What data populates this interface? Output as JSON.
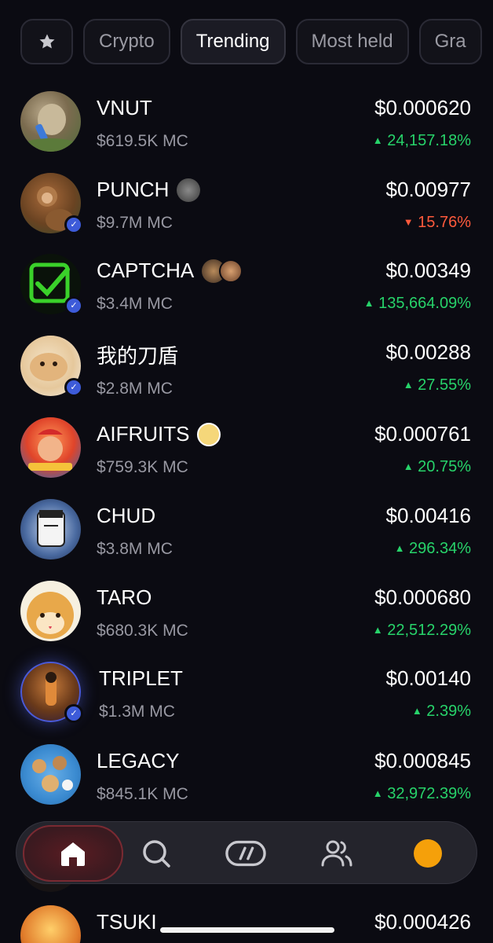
{
  "filters": {
    "items": [
      {
        "label": "Crypto",
        "active": false
      },
      {
        "label": "Trending",
        "active": true
      },
      {
        "label": "Most held",
        "active": false
      },
      {
        "label": "Gra",
        "active": false
      }
    ]
  },
  "tokens": [
    {
      "name": "VNUT",
      "mc": "$619.5K MC",
      "price": "$0.000620",
      "change": "24,157.18%",
      "direction": "up"
    },
    {
      "name": "PUNCH",
      "mc": "$9.7M MC",
      "price": "$0.00977",
      "change": "15.76%",
      "direction": "down"
    },
    {
      "name": "CAPTCHA",
      "mc": "$3.4M MC",
      "price": "$0.00349",
      "change": "135,664.09%",
      "direction": "up"
    },
    {
      "name": "我的刀盾",
      "mc": "$2.8M MC",
      "price": "$0.00288",
      "change": "27.55%",
      "direction": "up"
    },
    {
      "name": "AIFRUITS",
      "mc": "$759.3K MC",
      "price": "$0.000761",
      "change": "20.75%",
      "direction": "up"
    },
    {
      "name": "CHUD",
      "mc": "$3.8M MC",
      "price": "$0.00416",
      "change": "296.34%",
      "direction": "up"
    },
    {
      "name": "TARO",
      "mc": "$680.3K MC",
      "price": "$0.000680",
      "change": "22,512.29%",
      "direction": "up"
    },
    {
      "name": "TRIPLET",
      "mc": "$1.3M MC",
      "price": "$0.00140",
      "change": "2.39%",
      "direction": "up"
    },
    {
      "name": "LEGACY",
      "mc": "$845.1K MC",
      "price": "$0.000845",
      "change": "32,972.39%",
      "direction": "up"
    },
    {
      "name": "TSUKI",
      "mc": "",
      "price": "$0.000426",
      "change": "",
      "direction": "up"
    }
  ],
  "icons": {
    "star": "star-icon",
    "home": "home-icon",
    "search": "search-icon",
    "swap": "swap-icon",
    "people": "people-icon",
    "profile": "profile-dot-icon",
    "verified": "verified-badge-icon",
    "up": "triangle-up-icon",
    "down": "triangle-down-icon"
  },
  "colors": {
    "background": "#0b0b12",
    "up": "#27d36a",
    "down": "#ff5a3c",
    "verified": "#3d5bd9",
    "profile_dot": "#f5a00a"
  }
}
